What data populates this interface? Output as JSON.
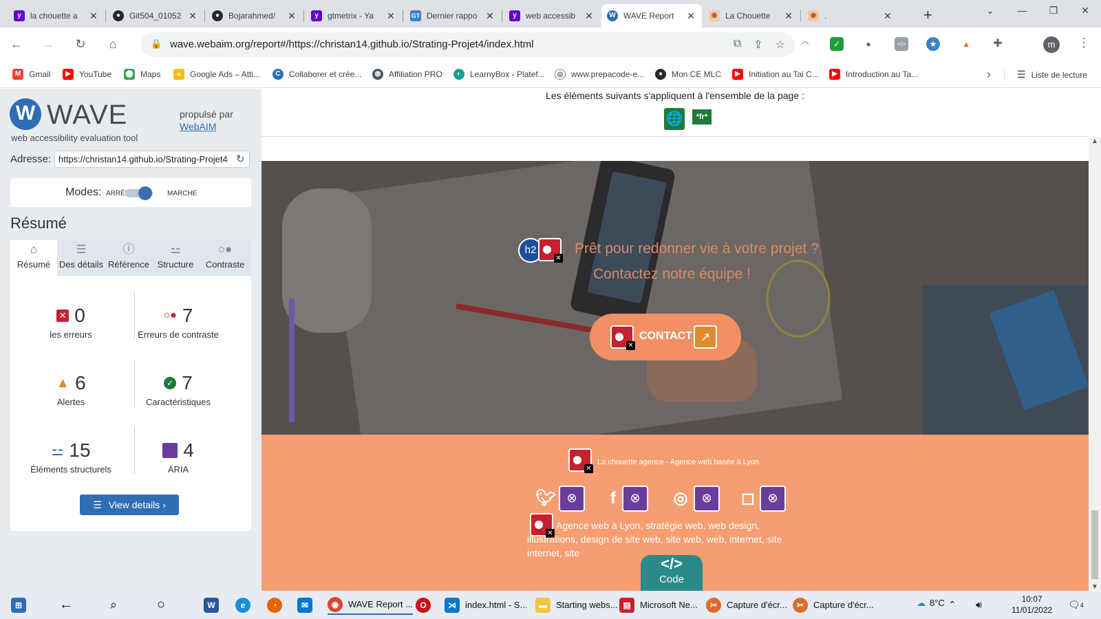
{
  "colors": {
    "wave_blue": "#2f6db5",
    "error_red": "#c8202f",
    "alert_orange": "#e08a2a",
    "feature_green": "#1f7a3a",
    "aria_purple": "#6a3d9a",
    "footer_orange": "#f79d72",
    "contact_orange": "#f28f63"
  },
  "browser": {
    "tabs": [
      {
        "title": "la chouette a",
        "icon": "yahoo-icon"
      },
      {
        "title": "Git504_01052",
        "icon": "github-icon"
      },
      {
        "title": "Bojarahmed/",
        "icon": "github-icon"
      },
      {
        "title": "gtmetrix - Ya",
        "icon": "yahoo-icon"
      },
      {
        "title": "Dernier rappo",
        "icon": "gtmetrix-icon"
      },
      {
        "title": "web accessib",
        "icon": "yahoo-icon"
      },
      {
        "title": "WAVE Report",
        "icon": "wave-icon"
      },
      {
        "title": "La Chouette",
        "icon": "owl-icon"
      },
      {
        "title": ".",
        "icon": "owl-icon"
      }
    ],
    "url": "wave.webaim.org/report#/https://christan14.github.io/Strating-Projet4/index.html",
    "bookmarks": [
      {
        "label": "Gmail",
        "icon": "gmail-icon"
      },
      {
        "label": "YouTube",
        "icon": "youtube-icon"
      },
      {
        "label": "Maps",
        "icon": "maps-icon"
      },
      {
        "label": "Google Ads – Atti...",
        "icon": "google-ads-icon"
      },
      {
        "label": "Collaborer et crée...",
        "icon": "canva-icon"
      },
      {
        "label": "Affiliation PRO",
        "icon": "affiliation-icon"
      },
      {
        "label": "LearnyBox - Platef...",
        "icon": "learnybox-icon"
      },
      {
        "label": "www.prepacode-e...",
        "icon": "prepacode-icon"
      },
      {
        "label": "Mon CE MLC",
        "icon": "github-icon"
      },
      {
        "label": "Initiation au Tai C...",
        "icon": "youtube-icon"
      },
      {
        "label": "Introduction au Ta...",
        "icon": "youtube-icon"
      }
    ],
    "reading_list": "Liste de lecture",
    "avatar_letter": "m"
  },
  "wave": {
    "title": "WAVE",
    "tagline": "web accessibility evaluation tool",
    "powered_by": "propulsé par",
    "powered_link": "WebAIM",
    "address_label": "Adresse:",
    "address_value": "https://christan14.github.io/Strating-Projet4",
    "modes_label": "Modes:",
    "mode_off": "ARRÊT",
    "mode_on": "MARCHE",
    "summary_heading": "Résumé",
    "tabs": [
      {
        "label": "Résumé",
        "icon": "home-icon"
      },
      {
        "label": "Des détails",
        "icon": "list-icon"
      },
      {
        "label": "Référence",
        "icon": "info-icon"
      },
      {
        "label": "Structure",
        "icon": "hierarchy-icon"
      },
      {
        "label": "Contraste",
        "icon": "contrast-icon"
      }
    ],
    "stats": {
      "errors": {
        "value": "0",
        "label": "les erreurs"
      },
      "contrast": {
        "value": "7",
        "label": "Erreurs de contraste"
      },
      "alerts": {
        "value": "6",
        "label": "Alertes"
      },
      "features": {
        "value": "7",
        "label": "Caractéristiques"
      },
      "structural": {
        "value": "15",
        "label": "Éléments structurels"
      },
      "aria": {
        "value": "4",
        "label": "ARIA"
      }
    },
    "view_details": "View details ›"
  },
  "preview": {
    "page_features_text": "Les éléments suivants s'appliquent à l'ensemble de la page :",
    "lang_badge": "*fr*",
    "h2_badge": "h2",
    "hero_line1": "Prêt pour redonner vie à votre projet ?",
    "hero_line2": "Contactez notre équipe !",
    "contact_label": "CONTACT",
    "footer_agency": "La chouette agence - Agence web basée à Lyon.",
    "footer_desc": "Agence web à Lyon, stratégie web, web design, illustrations, design de site web, site web, web, internet, site internet, site",
    "code_icon": "</>",
    "code_label": "Code"
  },
  "taskbar": {
    "items": [
      {
        "label": "WAVE Report ...",
        "icon": "chrome-icon"
      },
      {
        "label": "index.html - S...",
        "icon": "vscode-icon"
      },
      {
        "label": "Starting webs...",
        "icon": "folder-icon"
      },
      {
        "label": "Microsoft Ne...",
        "icon": "news-icon"
      },
      {
        "label": "Capture d'écr...",
        "icon": "snip-icon"
      },
      {
        "label": "Capture d'écr...",
        "icon": "snip-icon"
      }
    ],
    "weather": "8°C",
    "time": "10:07",
    "date": "11/01/2022",
    "notifications": "4"
  }
}
